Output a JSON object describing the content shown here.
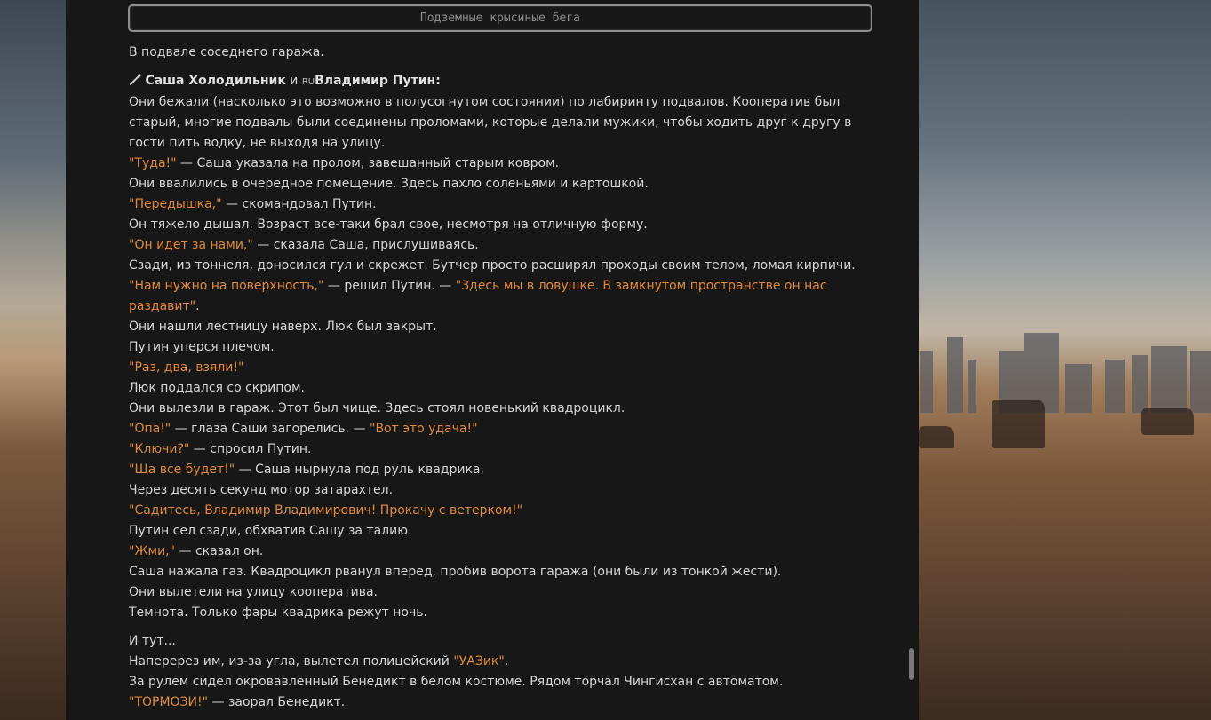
{
  "story": {
    "title": "Подземные крысиные бега",
    "location": "В подвале соседнего гаража.",
    "header": {
      "icon": "wand-icon",
      "char1": "Саша Холодильник",
      "and": " и ",
      "flag": "RU",
      "char2": "Владимир Путин",
      "colon": ":"
    },
    "lines": {
      "l1": "Они бежали (насколько это возможно в полусогнутом состоянии) по лабиринту подвалов. Кооператив был старый, многие подвалы были соединены проломами, которые делали мужики, чтобы ходить друг к другу в гости пить водку, не выходя на улицу.",
      "l2q": "\"Туда!\"",
      "l2t": " — Саша указала на пролом, завешанный старым ковром.",
      "l3": "Они ввалились в очередное помещение. Здесь пахло соленьями и картошкой.",
      "l4q": "\"Передышка,\"",
      "l4t": " — скомандовал Путин.",
      "l5": "Он тяжело дышал. Возраст все-таки брал свое, несмотря на отличную форму.",
      "l6q": "\"Он идет за нами,\"",
      "l6t": " — сказала Саша, прислушиваясь.",
      "l7": "Сзади, из тоннеля, доносился гул и скрежет. Бутчер просто расширял проходы своим телом, ломая кирпичи.",
      "l8q1": "\"Нам нужно на поверхность,\"",
      "l8t": " — решил Путин. — ",
      "l8q2": "\"Здесь мы в ловушке. В замкнутом пространстве он нас раздавит\"",
      "l8end": ".",
      "l9": "Они нашли лестницу наверх. Люк был закрыт.",
      "l10": "Путин уперся плечом.",
      "l11q": "\"Раз, два, взяли!\"",
      "l12": "Люк поддался со скрипом.",
      "l13": "Они вылезли в гараж. Этот был чище. Здесь стоял новенький квадроцикл.",
      "l14q1": "\"Опа!\"",
      "l14t": " — глаза Саши загорелись. — ",
      "l14q2": "\"Вот это удача!\"",
      "l15q": "\"Ключи?\"",
      "l15t": " — спросил Путин.",
      "l16q": "\"Ща все будет!\"",
      "l16t": " — Саша нырнула под руль квадрика.",
      "l17": "Через десять секунд мотор затарахтел.",
      "l18q": "\"Садитесь, Владимир Владимирович! Прокачу с ветерком!\"",
      "l19": "Путин сел сзади, обхватив Сашу за талию.",
      "l20q": "\"Жми,\"",
      "l20t": " — сказал он.",
      "l21": "Саша нажала газ. Квадроцикл рванул вперед, пробив ворота гаража (они были из тонкой жести).",
      "l22": "Они вылетели на улицу кооператива.",
      "l23": "Темнота. Только фары квадрика режут ночь.",
      "l24": "И тут...",
      "l25a": "Наперерез им, из-за угла, вылетел полицейский ",
      "l25q": "\"УАЗик\"",
      "l25end": ".",
      "l26": "За рулем сидел окровавленный Бенедикт в белом костюме. Рядом торчал Чингисхан с автоматом.",
      "l27q": "\"ТОРМОЗИ!\"",
      "l27t": " — заорал Бенедикт."
    }
  },
  "colors": {
    "quote": "#e08a3a",
    "text": "#d6d6d6",
    "panel": "#171717"
  }
}
